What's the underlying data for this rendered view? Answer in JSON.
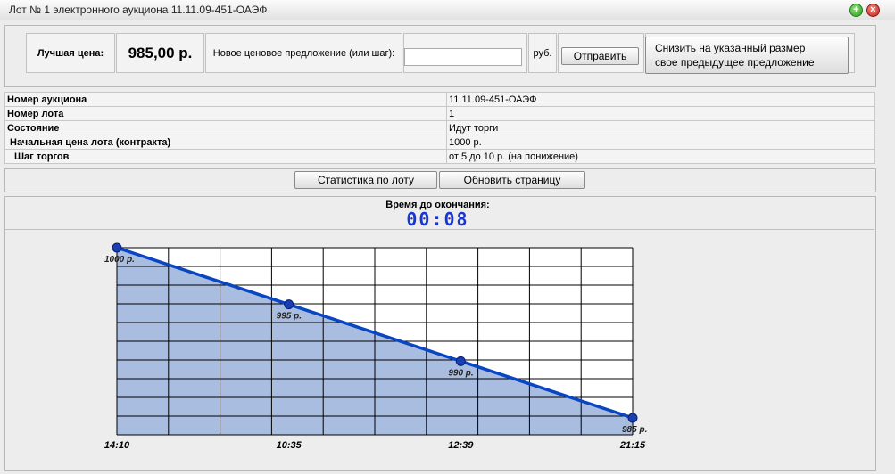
{
  "window": {
    "title": "Лот № 1 электронного аукциона 11.11.09-451-ОАЭФ"
  },
  "bid": {
    "best_price_label": "Лучшая цена:",
    "best_price_value": "985,00 р.",
    "new_offer_label": "Новое ценовое предложение (или шаг):",
    "new_offer_value": "",
    "currency": "руб.",
    "send_label": "Отправить",
    "reduce_line1": "Снизить на указанный размер",
    "reduce_line2": "свое предыдущее предложение"
  },
  "info": {
    "rows": [
      {
        "label": "Номер аукциона",
        "value": "11.11.09-451-ОАЭФ"
      },
      {
        "label": "Номер лота",
        "value": "1"
      },
      {
        "label": "Состояние",
        "value": "Идут торги"
      },
      {
        "label": "Начальная цена лота (контракта)",
        "value": "1000 р."
      },
      {
        "label": "Шаг торгов",
        "value": "от 5 до 10 р. (на понижение)"
      }
    ]
  },
  "actions": {
    "stats_label": "Статистика по лоту",
    "refresh_label": "Обновить страницу"
  },
  "timer": {
    "label": "Время до окончания:",
    "value": "00:08"
  },
  "chart_data": {
    "type": "area",
    "x": [
      "14:10",
      "10:35",
      "12:39",
      "21:15"
    ],
    "values": [
      1000,
      995,
      990,
      985
    ],
    "point_labels": [
      "1000 р.",
      "995 р.",
      "990 р.",
      "985 р."
    ],
    "ylim": [
      985,
      1000
    ],
    "grid": true,
    "colors": {
      "line": "#0a46c2",
      "fill": "#a9bde0",
      "point": "#1a3fb0"
    }
  }
}
